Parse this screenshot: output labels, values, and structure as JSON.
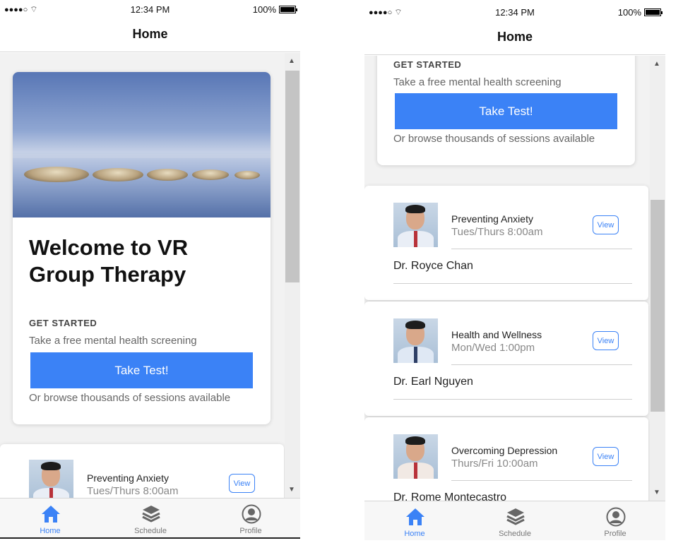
{
  "status": {
    "signal": "●●●●○",
    "wifi": "wifi",
    "time": "12:34 PM",
    "battery": "100%"
  },
  "nav": {
    "title": "Home"
  },
  "welcome": {
    "title_line1": "Welcome to VR",
    "title_line2": "Group Therapy",
    "get_started": "GET STARTED",
    "screening": "Take a free mental health screening",
    "button": "Take Test!",
    "browse": "Or browse thousands of sessions available"
  },
  "sessions": [
    {
      "title": "Preventing Anxiety",
      "time": "Tues/Thurs 8:00am",
      "doctor": "Dr. Royce Chan",
      "view": "View"
    },
    {
      "title": "Health and Wellness",
      "time": "Mon/Wed 1:00pm",
      "doctor": "Dr. Earl Nguyen",
      "view": "View"
    },
    {
      "title": "Overcoming Depression",
      "time": "Thurs/Fri 10:00am",
      "doctor": "Dr. Rome Montecastro",
      "view": "View"
    }
  ],
  "tabs": [
    {
      "label": "Home",
      "icon": "home-icon",
      "active": true
    },
    {
      "label": "Schedule",
      "icon": "layers-icon",
      "active": false
    },
    {
      "label": "Profile",
      "icon": "profile-icon",
      "active": false
    }
  ],
  "colors": {
    "accent": "#3b82f6",
    "inactive": "#777777"
  }
}
